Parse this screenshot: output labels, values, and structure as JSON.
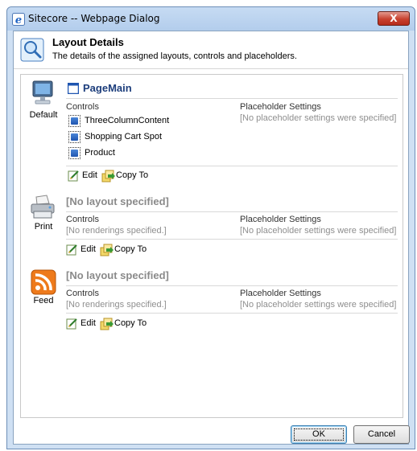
{
  "window": {
    "title": "Sitecore -- Webpage Dialog",
    "close_label": "X"
  },
  "header": {
    "title": "Layout Details",
    "description": "The details of the assigned layouts, controls and placeholders."
  },
  "devices": [
    {
      "label": "Default",
      "layout_name": "PageMain",
      "controls_heading": "Controls",
      "placeholder_heading": "Placeholder Settings",
      "placeholder_text": "[No placeholder settings were specified]",
      "controls": [
        "ThreeColumnContent",
        "Shopping Cart Spot",
        "Product"
      ],
      "edit_label": "Edit",
      "copy_label": "Copy To"
    },
    {
      "label": "Print",
      "layout_name": "[No layout specified]",
      "controls_heading": "Controls",
      "controls_text": "[No renderings specified.]",
      "placeholder_heading": "Placeholder Settings",
      "placeholder_text": "[No placeholder settings were specified]",
      "edit_label": "Edit",
      "copy_label": "Copy To"
    },
    {
      "label": "Feed",
      "layout_name": "[No layout specified]",
      "controls_heading": "Controls",
      "controls_text": "[No renderings specified.]",
      "placeholder_heading": "Placeholder Settings",
      "placeholder_text": "[No placeholder settings were specified]",
      "edit_label": "Edit",
      "copy_label": "Copy To"
    }
  ],
  "footer": {
    "ok_label": "OK",
    "cancel_label": "Cancel"
  },
  "icons": {
    "window": "internet-explorer-icon",
    "header": "magnifier-icon",
    "default_device": "monitor-icon",
    "print_device": "printer-icon",
    "feed_device": "rss-feed-icon"
  }
}
